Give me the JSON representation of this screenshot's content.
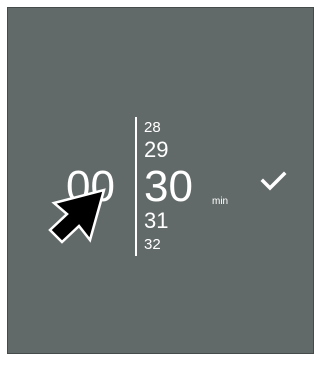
{
  "time_picker": {
    "hours": "00",
    "minutes": {
      "far_previous": "28",
      "previous": "29",
      "current": "30",
      "next": "31",
      "far_next": "32"
    },
    "unit": "min"
  },
  "icons": {
    "confirm": "checkmark-icon",
    "pointer": "mouse-pointer-icon"
  },
  "colors": {
    "panel_background": "#626a69",
    "foreground": "#ffffff",
    "pointer_fill": "#000000"
  }
}
